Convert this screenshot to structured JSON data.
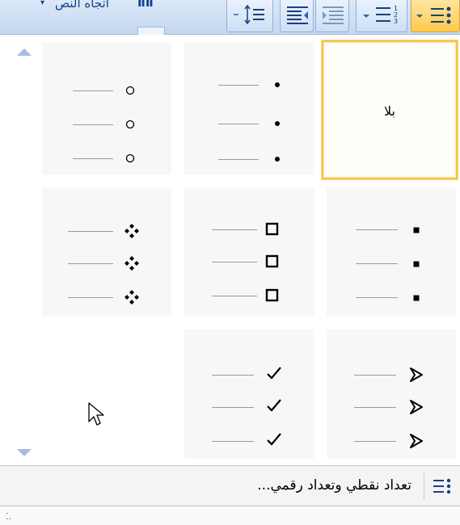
{
  "ribbon": {
    "text_direction_label": "اتجاه النص",
    "dropdown_arrow": "▾",
    "text_direction_icon": "ⅡⅡ",
    "buttons": [
      {
        "name": "line-spacing-button",
        "icon": "line-spacing-icon"
      },
      {
        "name": "increase-indent-button",
        "icon": "increase-indent-icon"
      },
      {
        "name": "decrease-indent-button",
        "icon": "decrease-indent-icon"
      },
      {
        "name": "numbering-button",
        "icon": "numbering-list-icon"
      },
      {
        "name": "bullets-button",
        "icon": "bullet-list-icon",
        "active": true
      }
    ]
  },
  "gallery": {
    "none_label": "بلا",
    "bullet_styles": [
      {
        "id": "none",
        "selected": true
      },
      {
        "id": "filled-dot"
      },
      {
        "id": "hollow-circle"
      },
      {
        "id": "small-square"
      },
      {
        "id": "hollow-square"
      },
      {
        "id": "four-diamonds"
      },
      {
        "id": "arrowhead"
      },
      {
        "id": "checkmark"
      },
      {
        "id": "empty"
      }
    ]
  },
  "footer": {
    "define_new_label": "تعداد نقطي وتعداد رقمي...",
    "grip": "⁚."
  },
  "colors": {
    "ribbon_blue": "#c5d8f1",
    "selection_gold": "#f5c14a",
    "active_orange": "#ffc94a"
  }
}
